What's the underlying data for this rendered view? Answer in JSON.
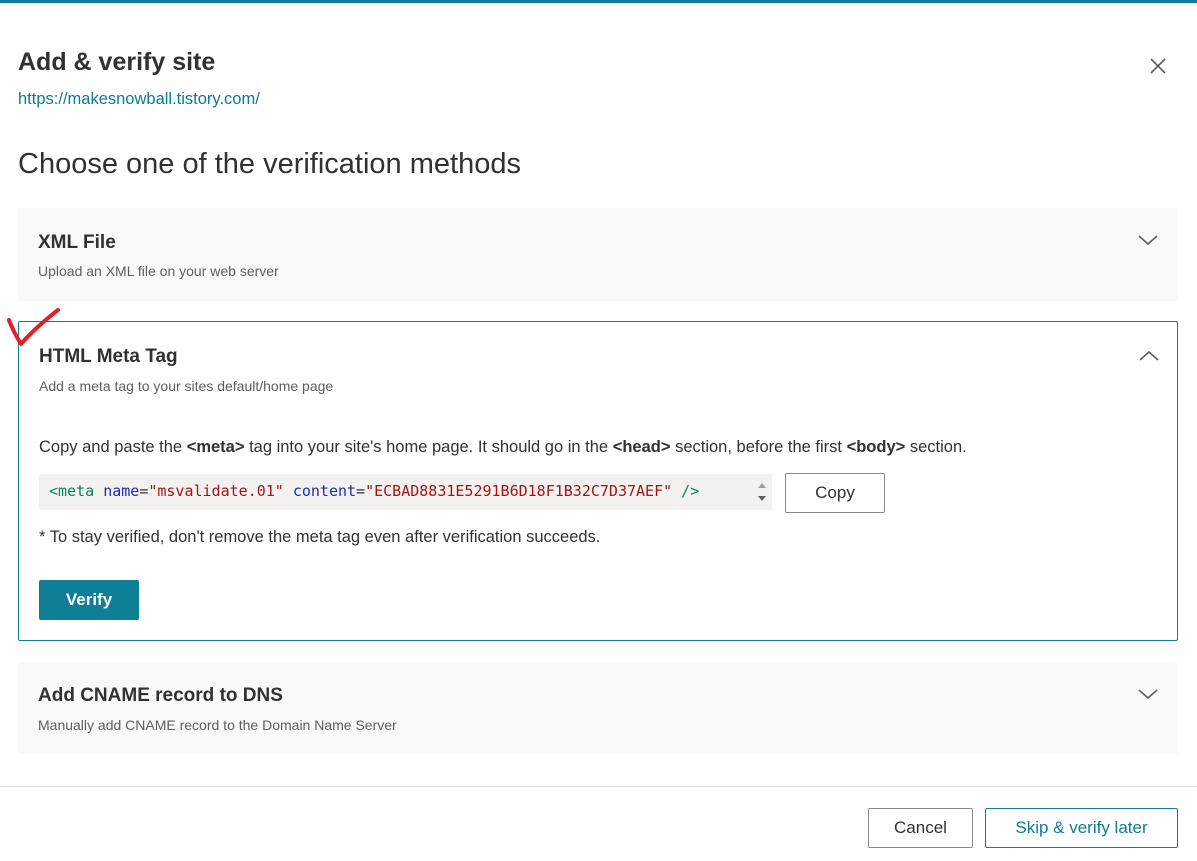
{
  "dialog": {
    "title": "Add & verify site",
    "site_url": "https://makesnowball.tistory.com/",
    "heading": "Choose one of the verification methods"
  },
  "methods": {
    "xml": {
      "title": "XML File",
      "subtitle": "Upload an XML file on your web server",
      "expanded": false
    },
    "meta": {
      "title": "HTML Meta Tag",
      "subtitle": "Add a meta tag to your sites default/home page",
      "expanded": true,
      "instructions": {
        "part1": "Copy and paste the ",
        "meta_tag": "<meta>",
        "part2": " tag into your site's home page. It should go in the ",
        "head_tag": "<head>",
        "part3": " section, before the first ",
        "body_tag": "<body>",
        "part4": " section."
      },
      "code": {
        "open": "<",
        "tag": "meta",
        "attr1": "name",
        "eq": "=",
        "val1": "\"msvalidate.01\"",
        "attr2": "content",
        "val2": "\"ECBAD8831E5291B6D18F1B32C7D37AEF\"",
        "close": "/>"
      },
      "copy_label": "Copy",
      "note": "* To stay verified, don't remove the meta tag even after verification succeeds.",
      "verify_label": "Verify"
    },
    "cname": {
      "title": "Add CNAME record to DNS",
      "subtitle": "Manually add CNAME record to the Domain Name Server",
      "expanded": false
    }
  },
  "footer": {
    "cancel_label": "Cancel",
    "skip_label": "Skip & verify later"
  },
  "colors": {
    "accent": "#0f7f95",
    "link": "#0f7a93",
    "annotation": "#e0202a"
  },
  "icons": {
    "close": "close-icon",
    "expand": "chevron-down-icon",
    "collapse": "chevron-up-icon",
    "annotation": "checkmark-annotation"
  }
}
